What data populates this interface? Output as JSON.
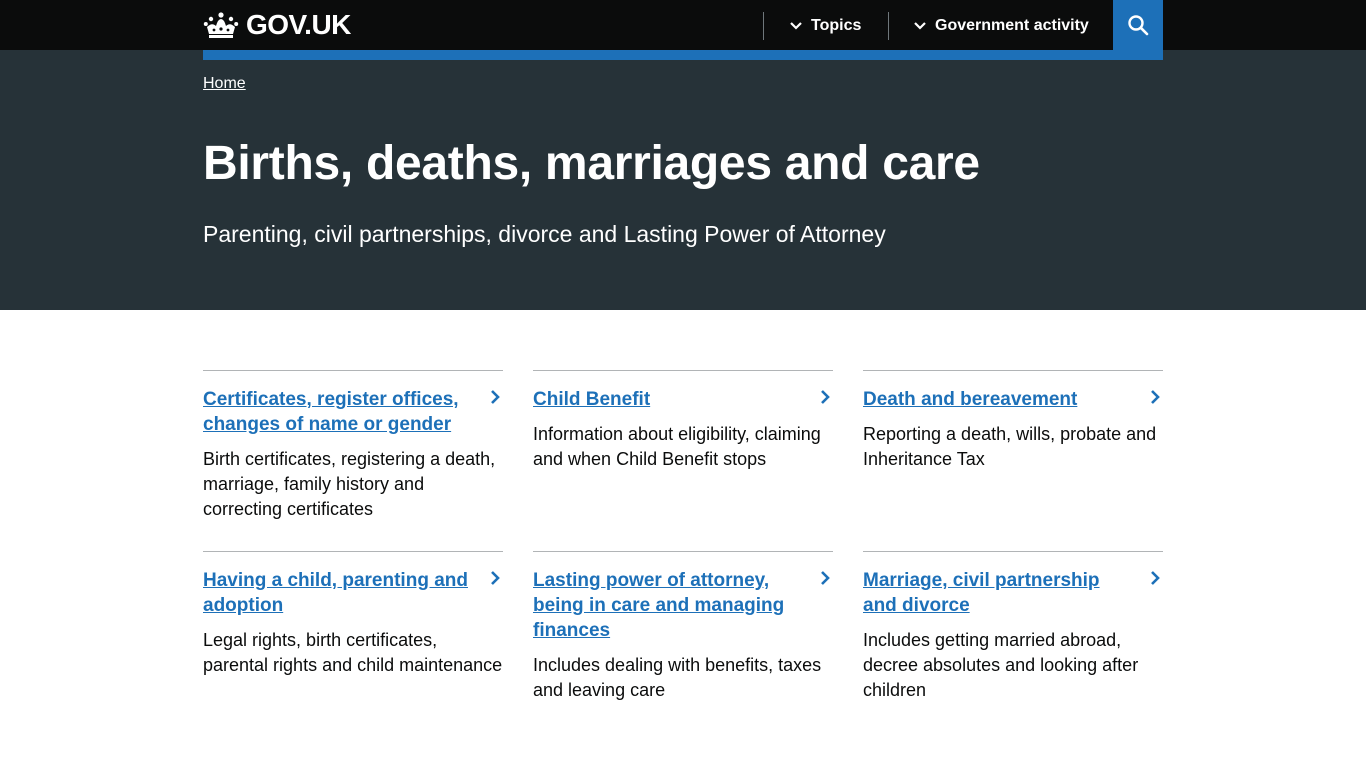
{
  "header": {
    "logo_text": "GOV.UK",
    "nav": [
      {
        "label": "Topics"
      },
      {
        "label": "Government activity"
      }
    ]
  },
  "breadcrumb": {
    "home": "Home"
  },
  "hero": {
    "title": "Births, deaths, marriages and care",
    "subtitle": "Parenting, civil partnerships, divorce and Lasting Power of Attorney"
  },
  "cards": [
    {
      "title": "Certificates, register offices, changes of name or gender",
      "description": "Birth certificates, registering a death, marriage, family history and correcting certificates"
    },
    {
      "title": "Child Benefit",
      "description": "Information about eligibility, claiming and when Child Benefit stops"
    },
    {
      "title": "Death and bereavement",
      "description": "Reporting a death, wills, probate and Inheritance Tax"
    },
    {
      "title": "Having a child, parenting and adoption",
      "description": "Legal rights, birth certificates, parental rights and child maintenance"
    },
    {
      "title": "Lasting power of attorney, being in care and managing finances",
      "description": "Includes dealing with benefits, taxes and leaving care"
    },
    {
      "title": "Marriage, civil partnership and divorce",
      "description": "Includes getting married abroad, decree absolutes and looking after children"
    }
  ],
  "colors": {
    "header_bg": "#0b0c0c",
    "hero_bg": "#263238",
    "brand_blue": "#1d70b8",
    "link": "#1d70b8",
    "text": "#0b0c0c"
  }
}
